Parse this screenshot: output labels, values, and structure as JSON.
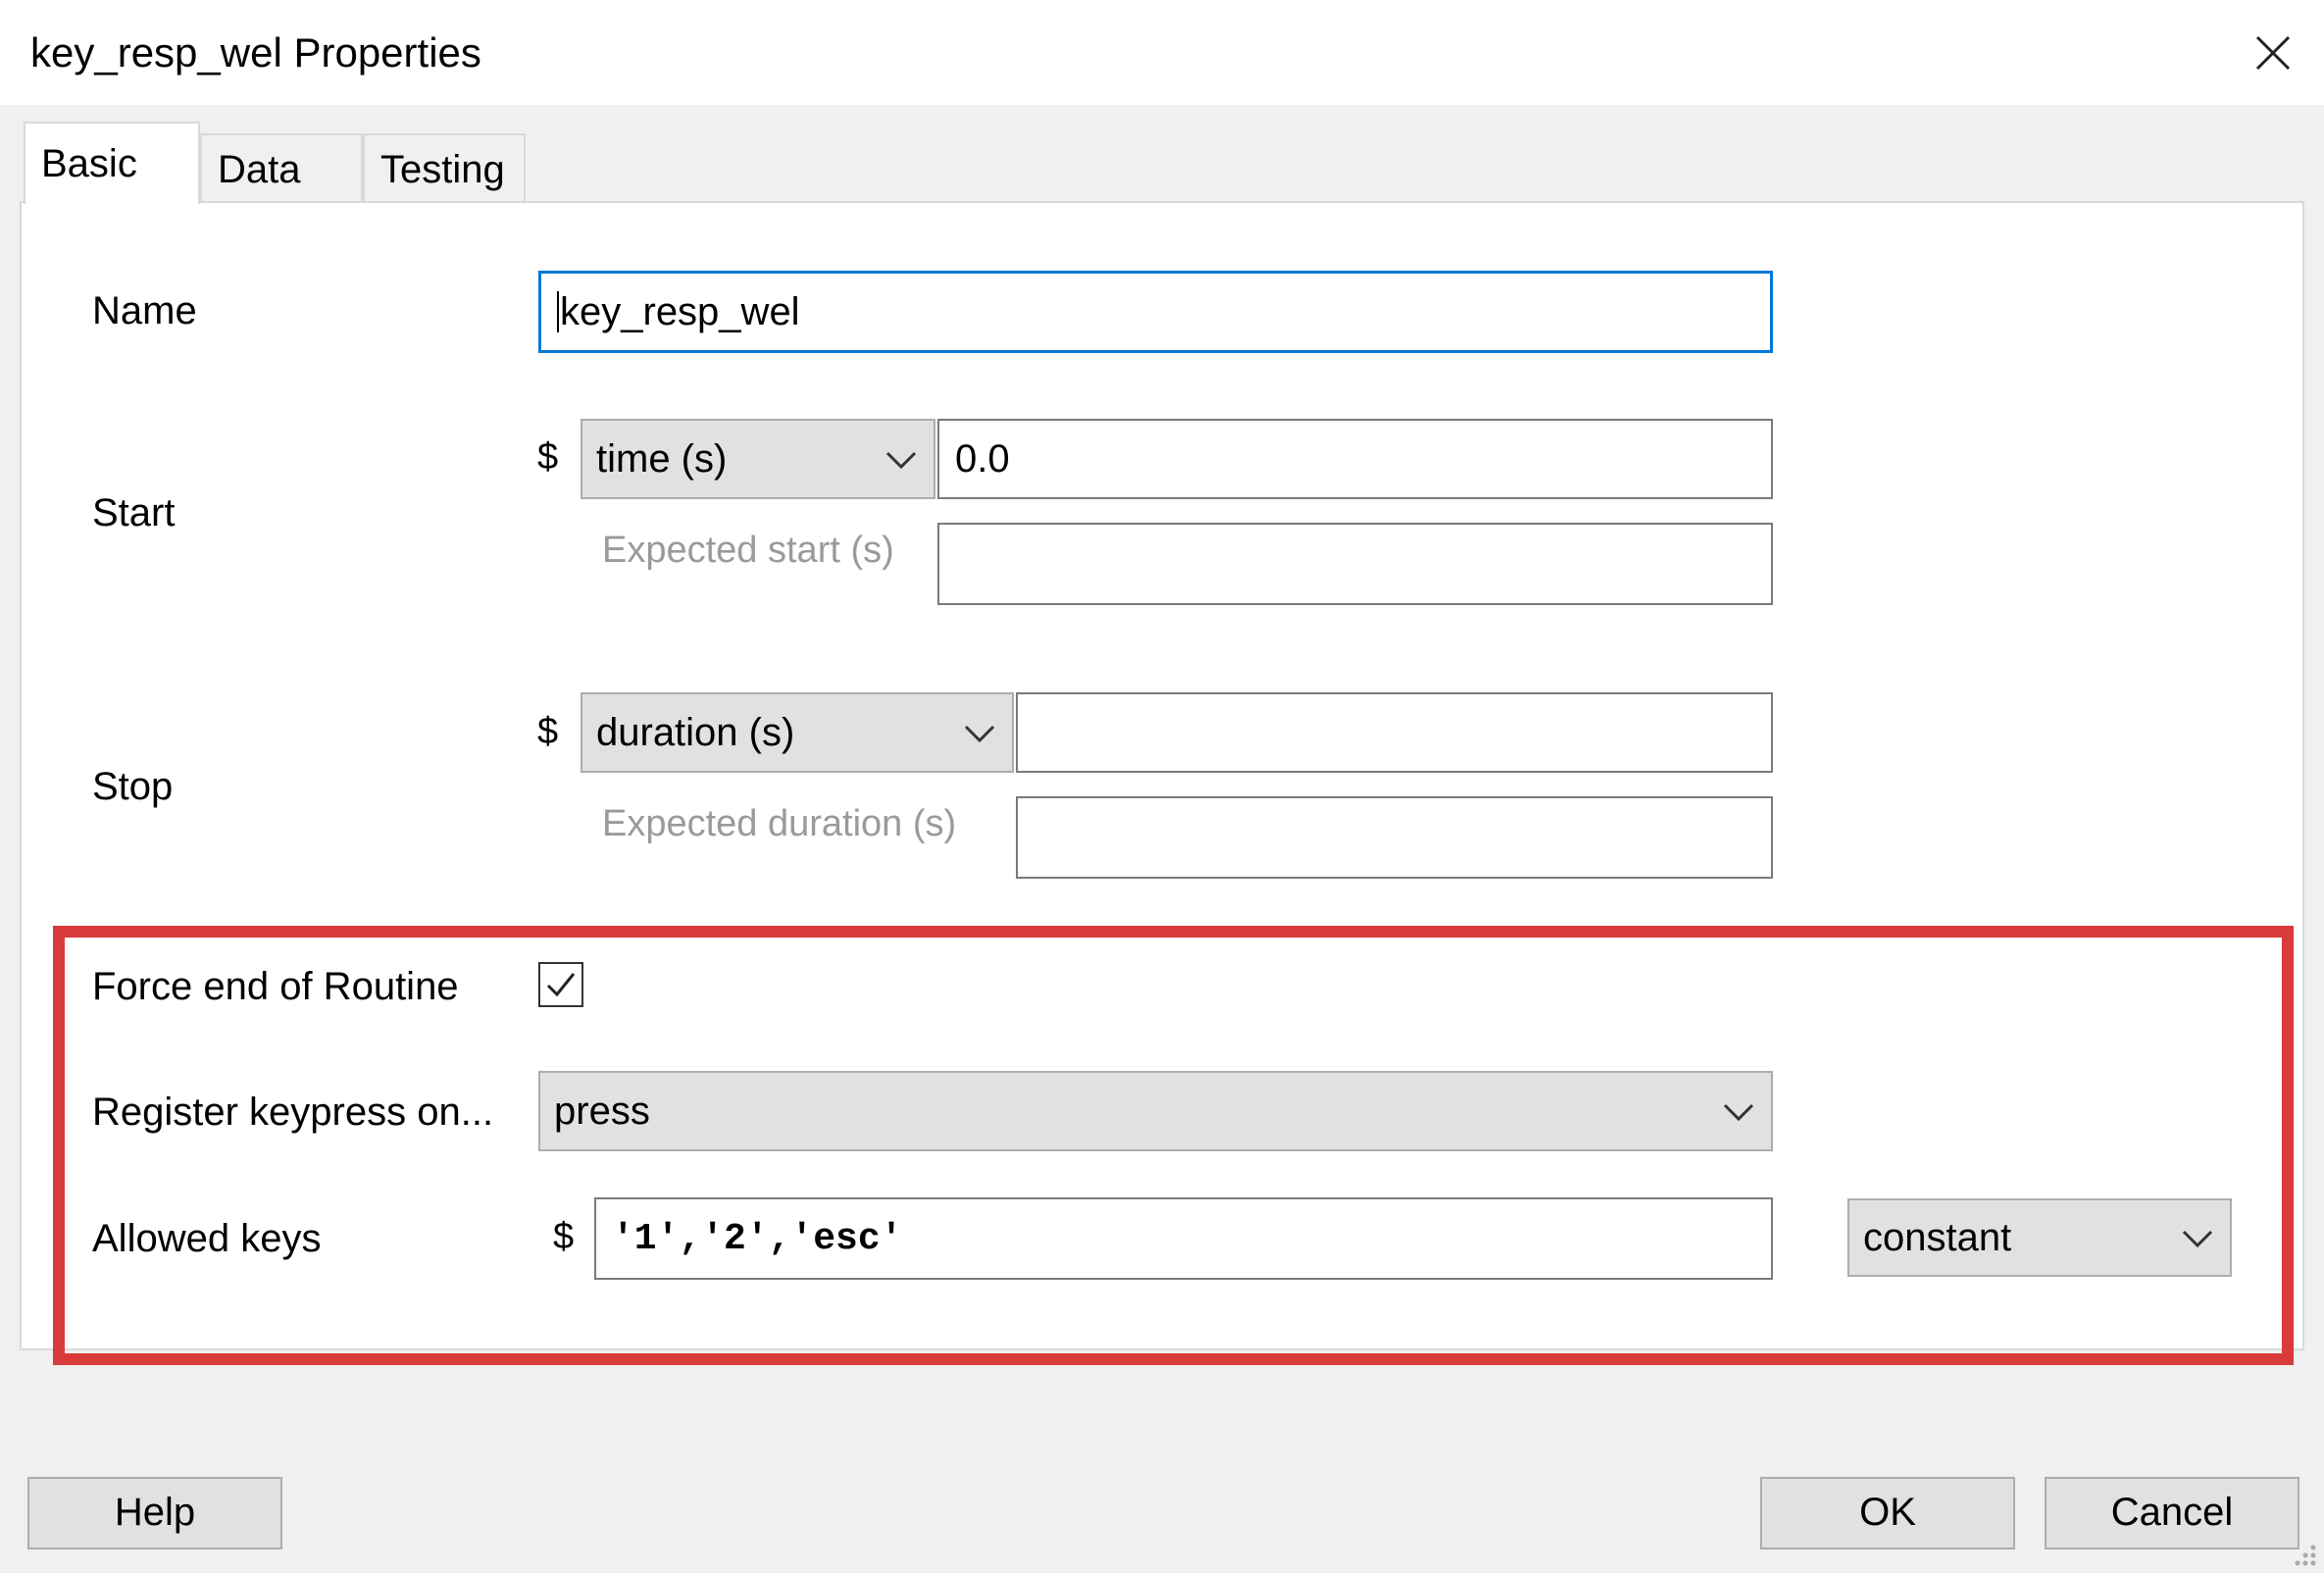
{
  "window": {
    "title": "key_resp_wel Properties"
  },
  "tabs": [
    {
      "label": "Basic",
      "active": true
    },
    {
      "label": "Data",
      "active": false
    },
    {
      "label": "Testing",
      "active": false
    }
  ],
  "fields": {
    "name": {
      "label": "Name",
      "value": "key_resp_wel"
    },
    "start": {
      "label": "Start",
      "dollar": "$",
      "type_value": "time (s)",
      "value": "0.0",
      "expected_label": "Expected start (s)",
      "expected_value": ""
    },
    "stop": {
      "label": "Stop",
      "dollar": "$",
      "type_value": "duration (s)",
      "value": "",
      "expected_label": "Expected duration (s)",
      "expected_value": ""
    },
    "force_end": {
      "label": "Force end of Routine",
      "checked": true
    },
    "register_keypress": {
      "label": "Register keypress on...",
      "value": "press"
    },
    "allowed_keys": {
      "label": "Allowed keys",
      "dollar": "$",
      "value": "'1','2','esc'",
      "update_value": "constant"
    }
  },
  "buttons": {
    "help": "Help",
    "ok": "OK",
    "cancel": "Cancel"
  },
  "colors": {
    "highlight": "#d93a3a",
    "focus": "#0078d7",
    "hint_text": "#9a9a9a"
  },
  "icons": {
    "close": "close-icon",
    "dropdown": "chevron-down-icon",
    "check": "checkmark-icon",
    "resize": "resize-grip-icon"
  }
}
